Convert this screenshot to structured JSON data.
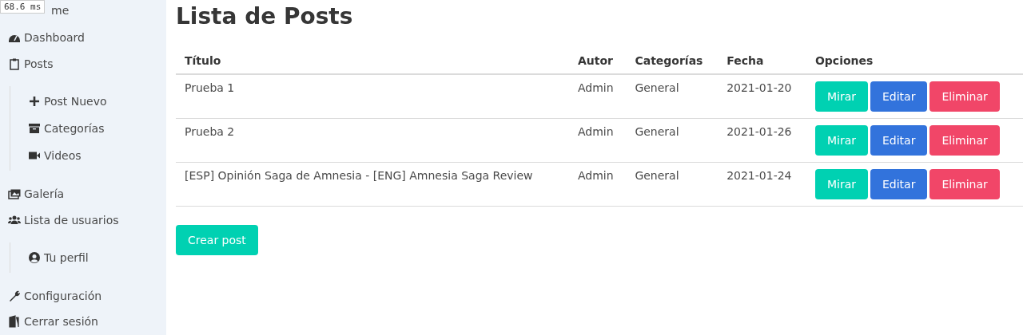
{
  "debug_badge": "68.6 ms",
  "sidebar": {
    "items": [
      {
        "label": "me"
      },
      {
        "label": "Dashboard"
      },
      {
        "label": "Posts",
        "children": [
          {
            "label": "Post Nuevo"
          },
          {
            "label": "Categorías"
          },
          {
            "label": "Videos"
          }
        ]
      },
      {
        "label": "Galería"
      },
      {
        "label": "Lista de usuarios",
        "children": [
          {
            "label": "Tu perfil"
          }
        ]
      },
      {
        "label": "Configuración"
      },
      {
        "label": "Cerrar sesión"
      }
    ]
  },
  "page_title": "Lista de Posts",
  "table": {
    "columns": [
      "Título",
      "Autor",
      "Categorías",
      "Fecha",
      "Opciones"
    ],
    "rows": [
      {
        "cells": [
          "Prueba 1",
          "Admin",
          "General",
          "2021-01-20"
        ],
        "buttons": [
          {
            "label": "Mirar",
            "kind": "view"
          },
          {
            "label": "Editar",
            "kind": "edit"
          },
          {
            "label": "Eliminar",
            "kind": "delete"
          }
        ]
      },
      {
        "cells": [
          "Prueba 2",
          "Admin",
          "General",
          "2021-01-26"
        ],
        "buttons": [
          {
            "label": "Mirar",
            "kind": "view"
          },
          {
            "label": "Editar",
            "kind": "edit"
          },
          {
            "label": "Eliminar",
            "kind": "delete"
          }
        ]
      },
      {
        "cells": [
          "[ESP] Opinión Saga de Amnesia - [ENG] Amnesia Saga Review",
          "Admin",
          "General",
          "2021-01-24"
        ],
        "buttons": [
          {
            "label": "Mirar",
            "kind": "view"
          },
          {
            "label": "Editar",
            "kind": "edit"
          },
          {
            "label": "Eliminar",
            "kind": "delete"
          }
        ]
      }
    ]
  },
  "create_button": "Crear post"
}
